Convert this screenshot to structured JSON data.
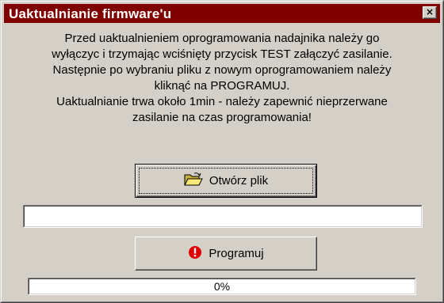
{
  "window": {
    "title": "Uaktualnianie firmware'u",
    "close_glyph": "×",
    "title_bar_color": "#800000"
  },
  "message": {
    "lines": [
      "Przed uaktualnieniem oprogramowania nadajnika należy go",
      "wyłączyc i trzymając wciśnięty przycisk TEST załączyć zasilanie.",
      "Następnie po wybraniu pliku z nowym oprogramowaniem należy",
      "kliknąć na PROGRAMUJ.",
      "Uaktualnianie trwa około 1min - należy zapewnić nieprzerwane",
      "zasilanie na czas programowania!"
    ]
  },
  "open_file_button": {
    "label": "Otwórz plik",
    "icon": "open-folder-icon"
  },
  "file_path_field": {
    "value": ""
  },
  "program_button": {
    "label": "Programuj",
    "icon": "warning-icon"
  },
  "progress": {
    "value": 0,
    "label": "0%"
  }
}
